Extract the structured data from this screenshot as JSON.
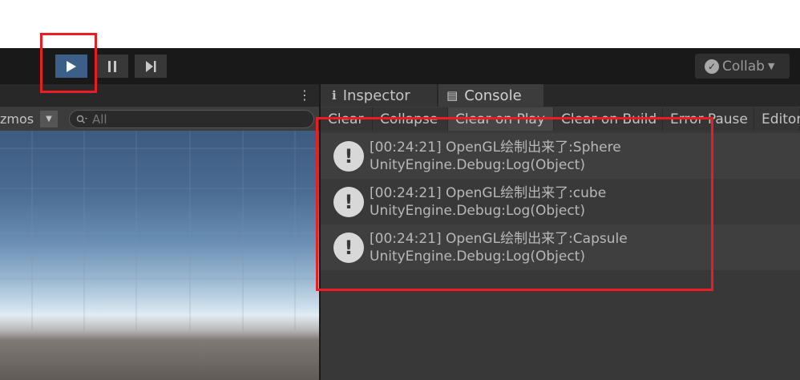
{
  "toolbar": {
    "play_icon": "play-icon",
    "pause_icon": "pause-icon",
    "step_icon": "step-icon",
    "collab_label": "Collab",
    "play_active_color": "#3c5f87"
  },
  "scene": {
    "gizmos_label": "zmos",
    "search_placeholder": "All"
  },
  "tabs": {
    "inspector": "Inspector",
    "console": "Console"
  },
  "console_toolbar": {
    "clear": "Clear",
    "collapse": "Collapse",
    "clear_on_play": "Clear on Play",
    "clear_on_build": "Clear on Build",
    "error_pause": "Error Pause",
    "editor": "Editor"
  },
  "logs": [
    {
      "line1": "[00:24:21] OpenGL绘制出来了:Sphere",
      "line2": "UnityEngine.Debug:Log(Object)"
    },
    {
      "line1": "[00:24:21] OpenGL绘制出来了:cube",
      "line2": "UnityEngine.Debug:Log(Object)"
    },
    {
      "line1": "[00:24:21] OpenGL绘制出来了:Capsule",
      "line2": "UnityEngine.Debug:Log(Object)"
    }
  ],
  "annotation_color": "#ec1c24"
}
